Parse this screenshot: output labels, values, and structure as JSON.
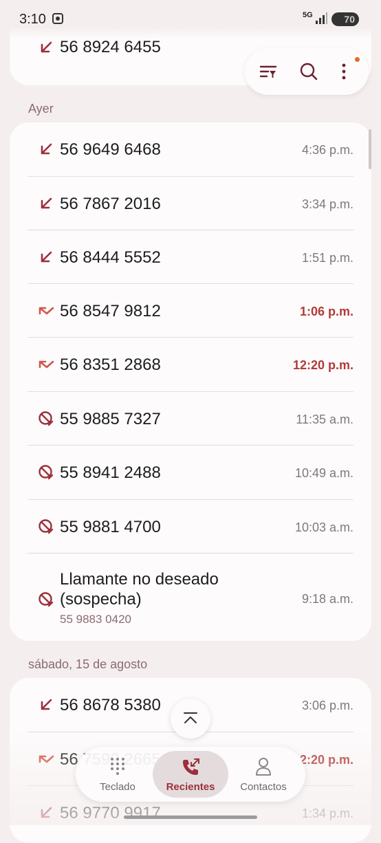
{
  "status_bar": {
    "time": "3:10",
    "network": "5G",
    "battery": "70"
  },
  "top_card": {
    "number": "56 8924 6455"
  },
  "toolbar_icons": [
    "filter-icon",
    "search-icon",
    "more-icon"
  ],
  "sections": [
    {
      "label": "Ayer",
      "calls": [
        {
          "type": "incoming",
          "icon": "incoming-call-icon",
          "number": "56 9649 6468",
          "time": "4:36 p.m."
        },
        {
          "type": "incoming",
          "icon": "incoming-call-icon",
          "number": "56 7867 2016",
          "time": "3:34 p.m."
        },
        {
          "type": "incoming",
          "icon": "incoming-call-icon",
          "number": "56 8444 5552",
          "time": "1:51 p.m."
        },
        {
          "type": "missed",
          "icon": "missed-call-icon",
          "number": "56 8547 9812",
          "time": "1:06 p.m."
        },
        {
          "type": "missed",
          "icon": "missed-call-icon",
          "number": "56 8351 2868",
          "time": "12:20 p.m."
        },
        {
          "type": "blocked",
          "icon": "blocked-call-icon",
          "number": "55 9885 7327",
          "time": "11:35 a.m."
        },
        {
          "type": "blocked",
          "icon": "blocked-call-icon",
          "number": "55 8941 2488",
          "time": "10:49 a.m."
        },
        {
          "type": "blocked",
          "icon": "blocked-call-icon",
          "number": "55 9881 4700",
          "time": "10:03 a.m."
        }
      ],
      "spam_call": {
        "icon": "blocked-call-icon",
        "name_line1": "Llamante no deseado",
        "name_line2": "(sospecha)",
        "number": "55 9883 0420",
        "time": "9:18 a.m."
      }
    },
    {
      "label": "sábado, 15 de agosto",
      "calls": [
        {
          "type": "incoming",
          "icon": "incoming-call-icon",
          "number": "56 8678 5380",
          "time": "3:06 p.m."
        },
        {
          "type": "missed",
          "icon": "missed-call-icon",
          "number": "56 7599 2665",
          "time": "2:20 p.m."
        },
        {
          "type": "incoming",
          "icon": "incoming-call-icon",
          "number": "56 9770 9917",
          "time": "1:34 p.m."
        }
      ]
    }
  ],
  "bottom_nav": [
    {
      "label": "Teclado",
      "icon": "keypad-icon"
    },
    {
      "label": "Recientes",
      "icon": "recents-icon",
      "active": true
    },
    {
      "label": "Contactos",
      "icon": "contacts-icon"
    }
  ],
  "colors": {
    "accent": "#9b2f3c",
    "missed": "#b13a38",
    "background": "#f5eeee",
    "card": "#fdfbfb"
  }
}
